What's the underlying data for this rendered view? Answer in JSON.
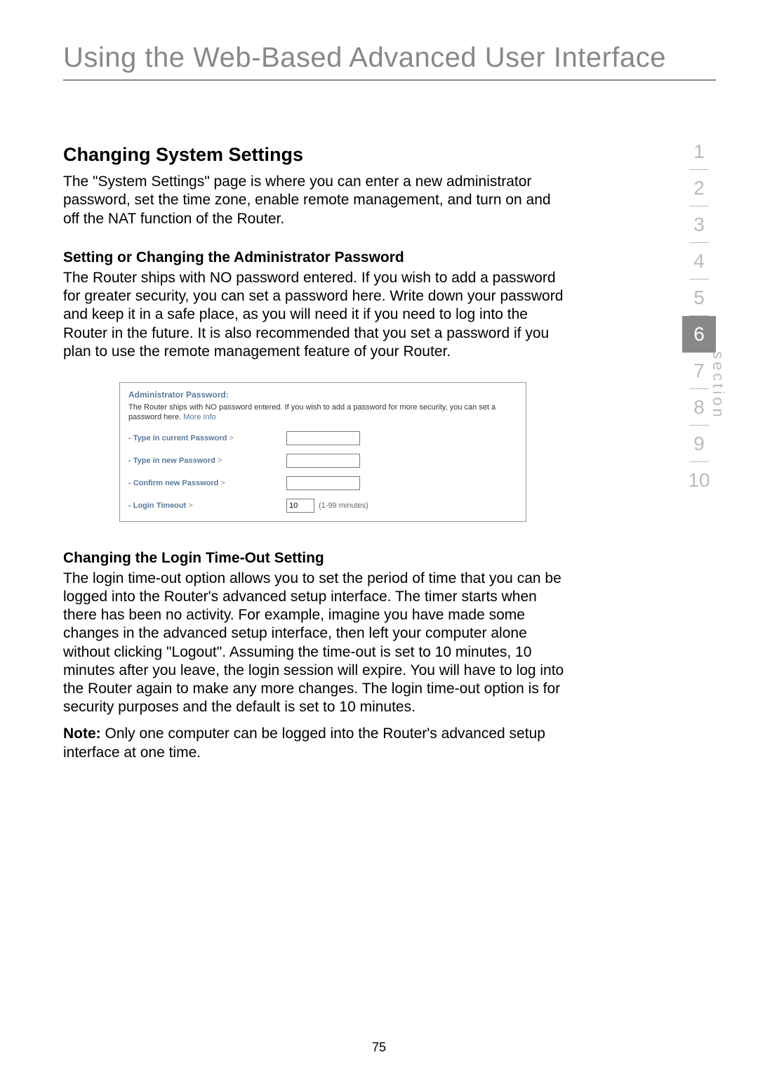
{
  "page_title": "Using the Web-Based Advanced User Interface",
  "h2": "Changing System Settings",
  "intro": "The \"System Settings\" page is where you can enter a new administrator password, set the time zone, enable remote management, and turn on and off the NAT function of the Router.",
  "sec1_h3": "Setting or Changing the Administrator Password",
  "sec1_p": "The Router ships with NO password entered. If you wish to add a password for greater security, you can set a password here. Write down your password and keep it in a safe place, as you will need it if you need to log into the Router in the future. It is also recommended that you set a password if you plan to use the remote management feature of your Router.",
  "panel": {
    "title": "Administrator Password:",
    "desc": "The Router ships with NO password entered. If you wish to add a password for more security, you can set a password here. ",
    "more_info": "More Info",
    "row1": "- Type in current Password ",
    "row2": "- Type in new Password ",
    "row3": "- Confirm new Password ",
    "row4": "- Login Timeout ",
    "gt": ">",
    "timeout_value": "10",
    "timeout_unit": "(1-99 minutes)"
  },
  "sec2_h3": "Changing the Login Time-Out Setting",
  "sec2_p": "The login time-out option allows you to set the period of time that you can be logged into the Router's advanced setup interface. The timer starts when there has been no activity. For example, imagine you have made some changes in the advanced setup interface, then left your computer alone without clicking \"Logout\". Assuming the time-out is set to 10 minutes, 10 minutes after you leave, the login session will expire. You will have to log into the Router again to make any more changes. The login time-out option is for security purposes and the default is set to 10 minutes.",
  "note_label": "Note:",
  "note_text": " Only one computer can be logged into the Router's advanced setup interface at one time.",
  "nav": {
    "items": [
      "1",
      "2",
      "3",
      "4",
      "5",
      "6",
      "7",
      "8",
      "9",
      "10"
    ],
    "active_index": 5,
    "word": "section"
  },
  "page_number": "75"
}
